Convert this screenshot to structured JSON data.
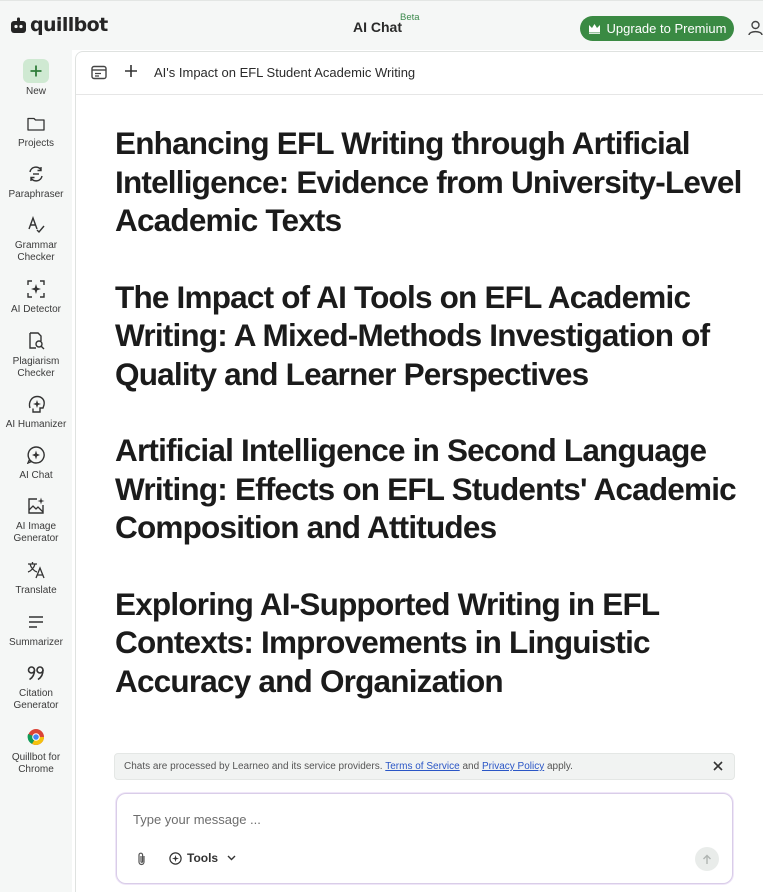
{
  "brand": {
    "name": "quillbot",
    "icon": "quillbot-logo-icon"
  },
  "header": {
    "title": "AI Chat",
    "badge": "Beta",
    "upgrade_label": "Upgrade to Premium",
    "upgrade_icon": "crown-icon",
    "user_icon": "user-icon",
    "accent_color": "#3a8a43"
  },
  "sidebar": {
    "items": [
      {
        "label": "New",
        "icon": "plus-icon"
      },
      {
        "label": "Projects",
        "icon": "folder-icon"
      },
      {
        "label": "Paraphraser",
        "icon": "paraphraser-icon"
      },
      {
        "label": "Grammar\nChecker",
        "icon": "grammar-check-icon"
      },
      {
        "label": "AI Detector",
        "icon": "ai-detector-icon"
      },
      {
        "label": "Plagiarism\nChecker",
        "icon": "plagiarism-icon"
      },
      {
        "label": "AI Humanizer",
        "icon": "humanizer-icon"
      },
      {
        "label": "AI Chat",
        "icon": "ai-chat-icon"
      },
      {
        "label": "AI Image\nGenerator",
        "icon": "image-generator-icon"
      },
      {
        "label": "Translate",
        "icon": "translate-icon"
      },
      {
        "label": "Summarizer",
        "icon": "summarizer-icon"
      },
      {
        "label": "Citation\nGenerator",
        "icon": "citation-icon"
      },
      {
        "label": "Quillbot for\nChrome",
        "icon": "chrome-icon"
      }
    ]
  },
  "chat": {
    "title": "AI's Impact on EFL Student Academic Writing",
    "headings": [
      "Enhancing EFL Writing through Artificial Intelligence: Evidence from University-Level Academic Texts",
      "The Impact of AI Tools on EFL Academic Writing: A Mixed-Methods Investigation of Quality and Learner Perspectives",
      "Artificial Intelligence in Second Language Writing: Effects on EFL Students' Academic Composition and Attitudes",
      "Exploring AI-Supported Writing in EFL Contexts: Improvements in Linguistic Accuracy and Organization"
    ]
  },
  "notice": {
    "prefix": "Chats are processed by Learneo and its service providers.",
    "terms": "Terms of Service",
    "and": "and",
    "privacy": "Privacy Policy",
    "suffix": "apply."
  },
  "composer": {
    "placeholder": "Type your message ...",
    "tools_label": "Tools"
  }
}
